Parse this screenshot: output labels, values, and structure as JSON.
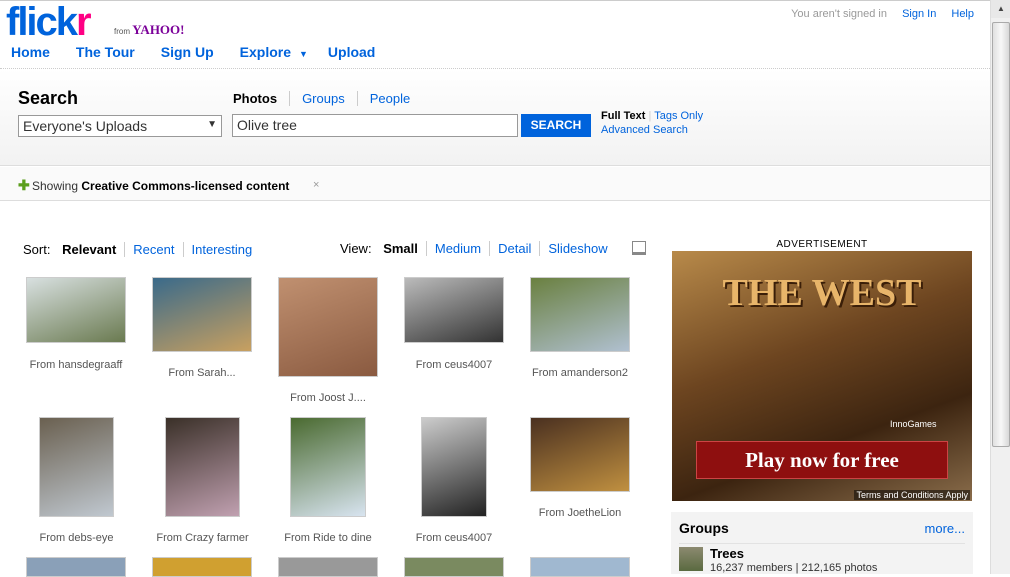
{
  "header": {
    "logo": "flickr",
    "from": "from",
    "yahoo": "YAHOO!",
    "signed_out": "You aren't signed in",
    "sign_in": "Sign In",
    "help": "Help",
    "nav": [
      "Home",
      "The Tour",
      "Sign Up",
      "Explore",
      "Upload"
    ]
  },
  "search": {
    "label": "Search",
    "scope": "Everyone's Uploads",
    "tabs": [
      "Photos",
      "Groups",
      "People"
    ],
    "query": "Olive tree",
    "button": "SEARCH",
    "full_text": "Full Text",
    "tags_only": "Tags Only",
    "advanced": "Advanced Search"
  },
  "filter": {
    "prefix": "Showing",
    "bold": "Creative Commons-licensed content",
    "close": "×"
  },
  "sort": {
    "label": "Sort:",
    "options": [
      "Relevant",
      "Recent",
      "Interesting"
    ]
  },
  "view": {
    "label": "View:",
    "options": [
      "Small",
      "Medium",
      "Detail",
      "Slideshow"
    ]
  },
  "photos": [
    {
      "caption": "From hansdegraaff",
      "colors": [
        "#6a7a50",
        "#d8e0e0"
      ]
    },
    {
      "caption": "From Sarah...",
      "colors": [
        "#c8a060",
        "#3a6a8a"
      ]
    },
    {
      "caption": "From Joost J....",
      "colors": [
        "#8a5a40",
        "#c09070"
      ]
    },
    {
      "caption": "From ceus4007",
      "colors": [
        "#333",
        "#bbb"
      ]
    },
    {
      "caption": "From amanderson2",
      "colors": [
        "#b0c0d0",
        "#6a8040"
      ]
    },
    {
      "caption": "From debs-eye",
      "colors": [
        "#c0c8d0",
        "#6a6050"
      ]
    },
    {
      "caption": "From Crazy farmer",
      "colors": [
        "#c0a0b0",
        "#3a3028"
      ]
    },
    {
      "caption": "From Ride to dine",
      "colors": [
        "#d8e4f0",
        "#4a6a30"
      ]
    },
    {
      "caption": "From ceus4007",
      "colors": [
        "#222",
        "#ccc"
      ]
    },
    {
      "caption": "From JoetheLion",
      "colors": [
        "#c09040",
        "#4a3020"
      ]
    }
  ],
  "ad": {
    "label": "ADVERTISEMENT",
    "title": "THE WEST",
    "cta": "Play now for free",
    "brand": "InnoGames",
    "terms": "Terms and Conditions Apply"
  },
  "groups": {
    "title": "Groups",
    "more": "more...",
    "items": [
      {
        "name": "Trees",
        "stats": "16,237 members | 212,165 photos"
      }
    ]
  }
}
